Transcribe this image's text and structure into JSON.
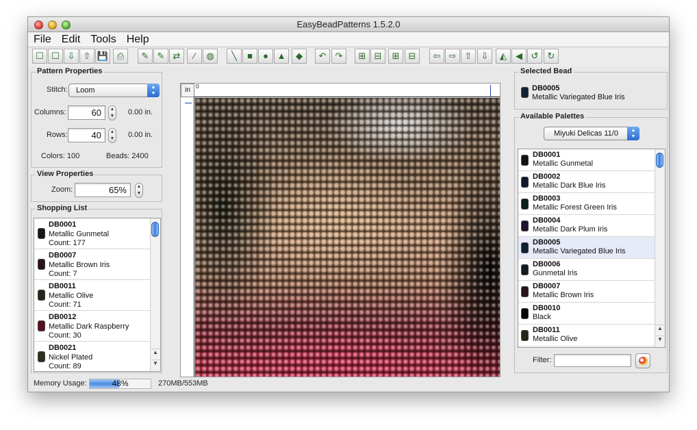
{
  "window": {
    "title": "EasyBeadPatterns 1.5.2.0"
  },
  "menu": [
    "File",
    "Edit",
    "Tools",
    "Help"
  ],
  "toolbar_icons": [
    "new-pattern-icon",
    "new-from-image-icon",
    "import-icon",
    "export-icon",
    "save-icon",
    "print-icon",
    "pencil-icon",
    "erase-pencil-icon",
    "replace-color-icon",
    "eyedropper-icon",
    "fill-bucket-icon",
    "line-icon",
    "rectangle-icon",
    "circle-icon",
    "triangle-icon",
    "diamond-icon",
    "undo-icon",
    "redo-icon",
    "insert-column-icon",
    "delete-column-icon",
    "insert-row-icon",
    "delete-row-icon",
    "shift-left-icon",
    "shift-right-icon",
    "shift-up-icon",
    "shift-down-icon",
    "flip-horizontal-icon",
    "flip-left-icon",
    "rotate-left-icon",
    "rotate-right-icon"
  ],
  "pattern_properties": {
    "title": "Pattern Properties",
    "stitch_label": "Stitch:",
    "stitch_value": "Loom",
    "columns_label": "Columns:",
    "columns_value": "60",
    "columns_inches": "0.00 in.",
    "rows_label": "Rows:",
    "rows_value": "40",
    "rows_inches": "0.00 in.",
    "colors_text": "Colors: 100",
    "beads_text": "Beads: 2400"
  },
  "view_properties": {
    "title": "View Properties",
    "zoom_label": "Zoom:",
    "zoom_value": "65%"
  },
  "shopping_list": {
    "title": "Shopping List",
    "items": [
      {
        "code": "DB0001",
        "name": "Metallic Gunmetal",
        "count": "Count: 177",
        "color": "#16171a"
      },
      {
        "code": "DB0007",
        "name": "Metallic Brown Iris",
        "count": "Count: 7",
        "color": "#2a1418"
      },
      {
        "code": "DB0011",
        "name": "Metallic Olive",
        "count": "Count: 71",
        "color": "#22271a"
      },
      {
        "code": "DB0012",
        "name": "Metallic Dark Raspberry",
        "count": "Count: 30",
        "color": "#5a1020"
      },
      {
        "code": "DB0021",
        "name": "Nickel Plated",
        "count": "Count: 89",
        "color": "#2f3021"
      }
    ]
  },
  "grid": {
    "ruler_unit": "in",
    "ruler_zero": "0"
  },
  "selected_bead": {
    "title": "Selected Bead",
    "code": "DB0005",
    "name": "Metallic Variegated Blue Iris",
    "color": "#122033"
  },
  "palettes": {
    "title": "Available Palettes",
    "palette_value": "Miyuki Delicas 11/0",
    "filter_label": "Filter:",
    "items": [
      {
        "code": "DB0001",
        "name": "Metallic Gunmetal",
        "color": "#101215"
      },
      {
        "code": "DB0002",
        "name": "Metallic Dark Blue Iris",
        "color": "#101a2b"
      },
      {
        "code": "DB0003",
        "name": "Metallic Forest Green Iris",
        "color": "#0f2018"
      },
      {
        "code": "DB0004",
        "name": "Metallic Dark Plum Iris",
        "color": "#22122e"
      },
      {
        "code": "DB0005",
        "name": "Metallic Variegated Blue Iris",
        "color": "#122033"
      },
      {
        "code": "DB0006",
        "name": "Gunmetal Iris",
        "color": "#141a24"
      },
      {
        "code": "DB0007",
        "name": "Metallic Brown Iris",
        "color": "#2a1418"
      },
      {
        "code": "DB0010",
        "name": "Black",
        "color": "#050505"
      },
      {
        "code": "DB0011",
        "name": "Metallic Olive",
        "color": "#22271a"
      }
    ]
  },
  "status": {
    "memory_label": "Memory Usage:",
    "memory_percent": "48%",
    "memory_fraction": 0.48,
    "memory_text": "270MB/553MB"
  }
}
